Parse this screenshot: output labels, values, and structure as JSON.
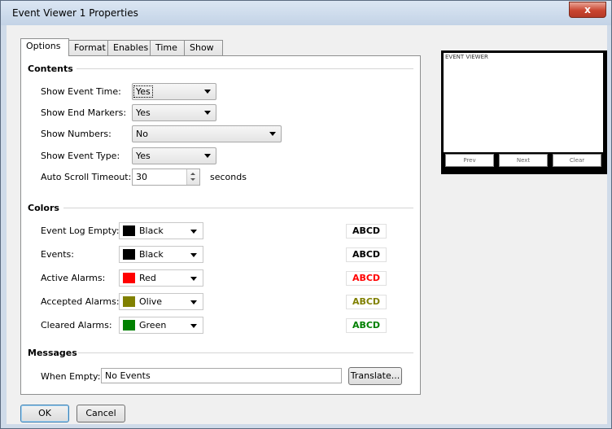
{
  "window": {
    "title": "Event Viewer 1 Properties",
    "close_glyph": "x"
  },
  "tabs": [
    "Options",
    "Format",
    "Enables",
    "Time",
    "Show"
  ],
  "contents": {
    "title": "Contents",
    "show_event_time": {
      "label": "Show Event Time:",
      "value": "Yes"
    },
    "show_end_markers": {
      "label": "Show End Markers:",
      "value": "Yes"
    },
    "show_numbers": {
      "label": "Show Numbers:",
      "value": "No"
    },
    "show_event_type": {
      "label": "Show Event Type:",
      "value": "Yes"
    },
    "auto_scroll": {
      "label": "Auto Scroll Timeout:",
      "value": "30",
      "unit": "seconds"
    }
  },
  "colors": {
    "title": "Colors",
    "sample_text": "ABCD",
    "rows": [
      {
        "label": "Event Log Empty:",
        "value": "Black",
        "hex": "#000000"
      },
      {
        "label": "Events:",
        "value": "Black",
        "hex": "#000000"
      },
      {
        "label": "Active Alarms:",
        "value": "Red",
        "hex": "#ff0000"
      },
      {
        "label": "Accepted Alarms:",
        "value": "Olive",
        "hex": "#808000"
      },
      {
        "label": "Cleared Alarms:",
        "value": "Green",
        "hex": "#008000"
      }
    ]
  },
  "messages": {
    "title": "Messages",
    "when_empty_label": "When Empty:",
    "when_empty_value": "No Events",
    "translate_label": "Translate..."
  },
  "buttons": {
    "ok": "OK",
    "cancel": "Cancel"
  },
  "preview": {
    "title": "EVENT VIEWER",
    "prev": "Prev",
    "next": "Next",
    "clear": "Clear"
  }
}
